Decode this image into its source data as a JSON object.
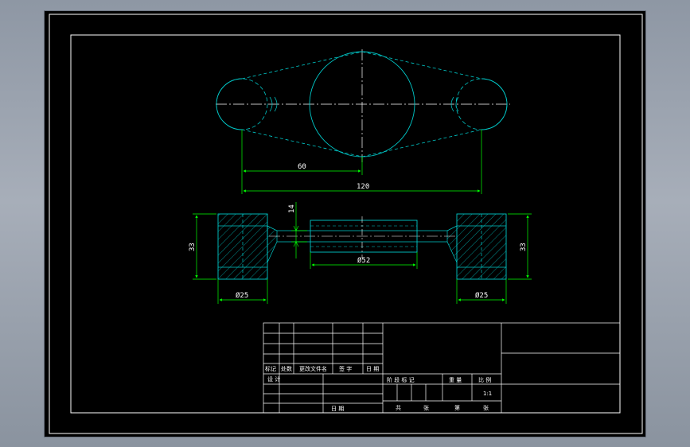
{
  "drawing": {
    "colors": {
      "background": "#000000",
      "border": "#ffffff",
      "outline": "#00c8c8",
      "dimension": "#00ff00",
      "text": "#ffffff",
      "centerline": "#ffffff"
    },
    "top_view": {
      "dimensions": {
        "half_span": "60",
        "full_span": "120"
      }
    },
    "section_view": {
      "dimensions": {
        "left_height": "33",
        "right_height": "33",
        "left_bore": "Ø25",
        "right_bore": "Ø25",
        "middle_diameter": "Ø52",
        "thickness": "14"
      }
    },
    "title_block": {
      "revision_headers": [
        "标记",
        "处数",
        "更改文件名",
        "签 字",
        "日 期"
      ],
      "designer_label": "设 计",
      "date_label": "日 期",
      "stage_label": "阶 段 标 记",
      "weight_label": "重 量",
      "scale_label": "比 例",
      "scale_value": "1:1",
      "total_label": "共",
      "sheets_label": "张",
      "page_label": "第",
      "sheet_label": "张"
    }
  }
}
